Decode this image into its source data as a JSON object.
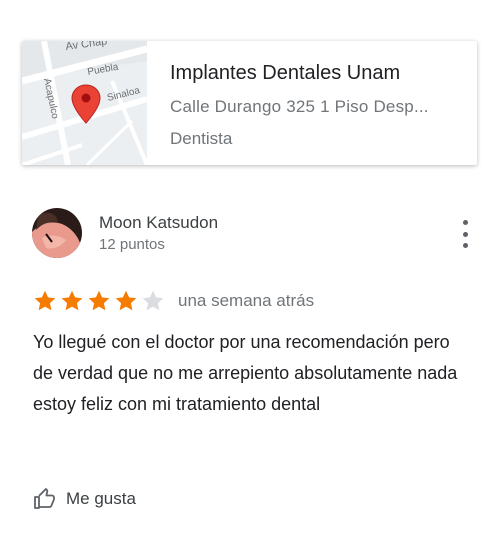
{
  "place": {
    "name": "Implantes Dentales Unam",
    "address": "Calle Durango 325 1 Piso Desp...",
    "category": "Dentista",
    "map_labels": {
      "street_top": "Av Chap",
      "street_puebla": "Puebla",
      "street_sinaloa": "Sinaloa",
      "street_acapulco": "Acapulco"
    }
  },
  "review": {
    "author": "Moon Katsudon",
    "points": "12 puntos",
    "rating": 4,
    "rating_max": 5,
    "date": "una semana atrás",
    "text": "Yo llegué con el doctor por una recomendación pero de verdad que no me arrepiento absolutamente nada estoy feliz con mi tratamiento dental",
    "like_label": "Me gusta"
  },
  "colors": {
    "star_filled": "#f57c00",
    "star_empty": "#dadce0",
    "map_pin": "#ea4335"
  }
}
